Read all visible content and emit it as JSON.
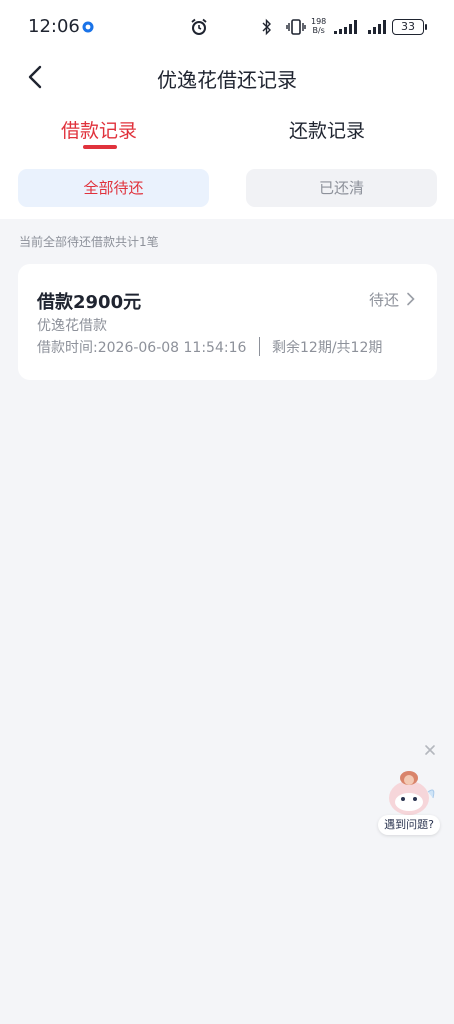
{
  "status_bar": {
    "time": "12:06",
    "net_speed_value": "198",
    "net_speed_unit": "B/s",
    "battery": "33"
  },
  "header": {
    "title": "优逸花借还记录"
  },
  "tabs": [
    {
      "label": "借款记录",
      "active": true
    },
    {
      "label": "还款记录",
      "active": false
    }
  ],
  "filters": [
    {
      "label": "全部待还",
      "active": true
    },
    {
      "label": "已还清",
      "active": false
    }
  ],
  "summary": "当前全部待还借款共计1笔",
  "loans": [
    {
      "amount": "借款2900元",
      "status": "待还",
      "product": "优逸花借款",
      "time": "借款时间:2026-06-08 11:54:16",
      "periods": "剩余12期/共12期"
    }
  ],
  "helper": {
    "label": "遇到问题?"
  },
  "colors": {
    "accent": "#e0323c",
    "background": "#f4f5f8",
    "text": "#1f2430",
    "muted": "#8d919a",
    "filter_active_bg": "#eaf2fd"
  },
  "icons": [
    "app-notification-icon",
    "alarm-icon",
    "bluetooth-icon",
    "vibrate-icon",
    "signal-icon",
    "battery-icon",
    "back-arrow-icon",
    "chevron-right-icon",
    "close-icon",
    "helper-mascot-icon"
  ]
}
